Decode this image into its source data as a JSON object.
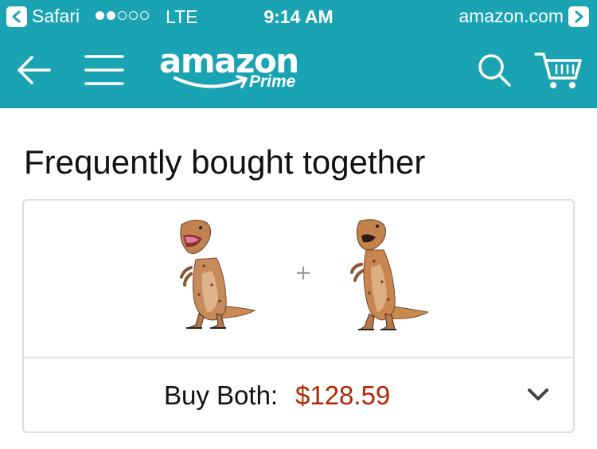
{
  "status_bar": {
    "back_app": "Safari",
    "carrier": "LTE",
    "time": "9:14 AM",
    "site": "amazon.com",
    "signal_bars_filled": 2,
    "signal_bars_total": 5
  },
  "nav": {
    "brand": "amazon",
    "tier": "Prime",
    "icons": [
      "back-arrow-icon",
      "hamburger-menu-icon",
      "search-icon",
      "cart-icon"
    ]
  },
  "section": {
    "title": "Frequently bought together"
  },
  "bundle": {
    "products": [
      {
        "name": "inflatable-trex-costume-1"
      },
      {
        "name": "inflatable-trex-costume-2"
      }
    ],
    "plus": "+",
    "buy_label": "Buy Both:",
    "buy_price": "$128.59"
  },
  "colors": {
    "header_teal": "#1aa3b3",
    "price_red": "#b12704",
    "border_gray": "#dddddd"
  }
}
